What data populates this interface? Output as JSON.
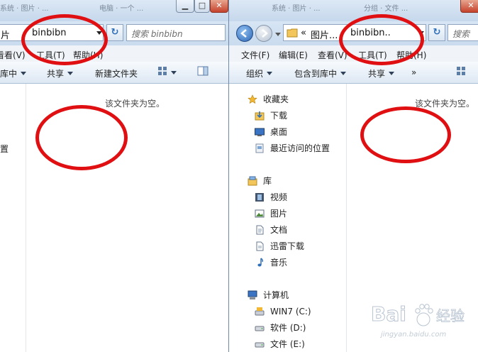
{
  "left": {
    "tabs": [
      "系统 · 图片 · ...",
      "电脑 · 一个 ...",
      "分组 · 文件 ..."
    ],
    "address": {
      "crumb": "片",
      "value": "binbibn"
    },
    "search_placeholder": "搜索 binbibn",
    "menu": [
      "看看(V)",
      "工具(T)",
      "帮助(H)"
    ],
    "toolbar": [
      "库中",
      "共享",
      "新建文件夹"
    ],
    "nav_partial": "置",
    "empty": "该文件夹为空。"
  },
  "right": {
    "address": {
      "crumb": "图片...",
      "value": "binbibn.."
    },
    "search_placeholder": "搜索",
    "menu": [
      "文件(F)",
      "编辑(E)",
      "查看(V)",
      "工具(T)",
      "帮助(H)"
    ],
    "toolbar": [
      "组织",
      "包含到库中",
      "共享",
      "»"
    ],
    "nav": {
      "favorites_header": "收藏夹",
      "favorites": [
        "下载",
        "桌面",
        "最近访问的位置"
      ],
      "library_header": "库",
      "library": [
        "视频",
        "图片",
        "文档",
        "迅雷下载",
        "音乐"
      ],
      "computer_header": "计算机",
      "drives": [
        "WIN7 (C:)",
        "软件 (D:)",
        "文件 (E:)"
      ]
    },
    "empty": "该文件夹为空。"
  },
  "watermark": {
    "brand": "Baidu 经验",
    "url": "jingyan.baidu.com"
  },
  "colors": {
    "annotation": "#e00f12",
    "chrome": "#d5e3f2",
    "accent": "#2f6fb8"
  }
}
